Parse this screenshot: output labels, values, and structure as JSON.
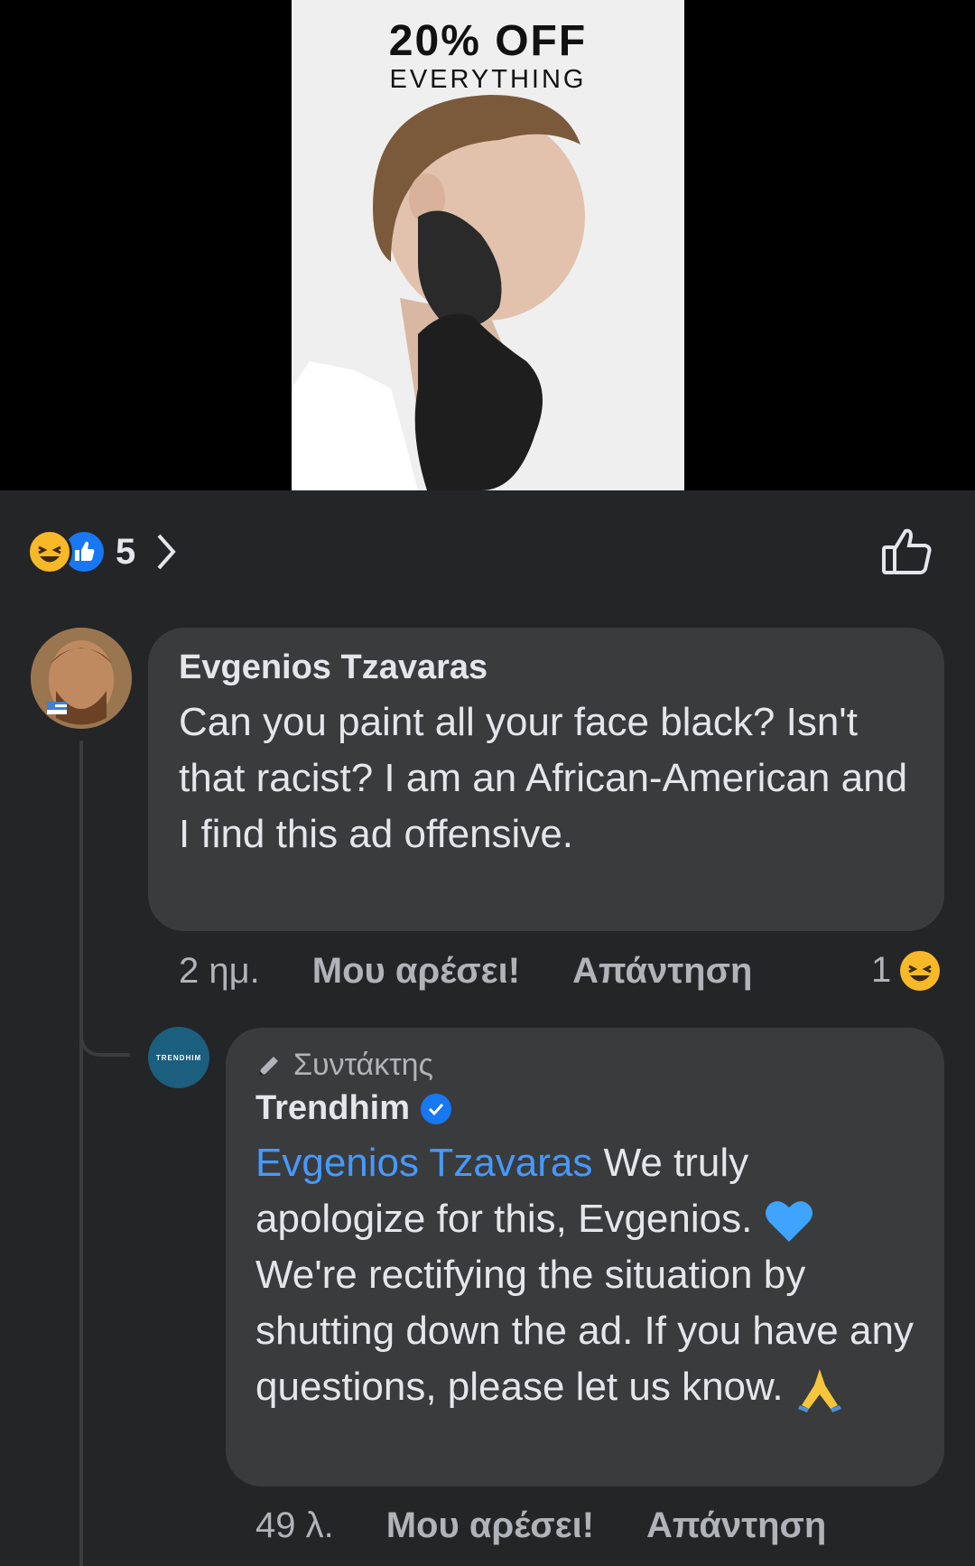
{
  "ad": {
    "headline": "20% OFF",
    "subline": "EVERYTHING"
  },
  "reactions": {
    "types": [
      "haha-icon",
      "like-icon"
    ],
    "count": "5"
  },
  "comments": [
    {
      "author": "Evgenios Tzavaras",
      "text": "Can you paint all your face black? Isn't that racist? I am an African-American and I find this ad offensive.",
      "time": "2 ημ.",
      "like_label": "Μου αρέσει!",
      "reply_label": "Απάντηση",
      "reaction_count": "1"
    }
  ],
  "reply": {
    "role": "Συντάκτης",
    "author": "Trendhim",
    "avatar_text": "TRENDHIM",
    "mention": "Evgenios Tzavaras",
    "text_part1": " We truly apologize for this, Evgenios. ",
    "text_part2": " We're rectifying the situation by shutting down the ad. If you have any questions, please let us know. ",
    "time": "49 λ.",
    "like_label": "Μου αρέσει!",
    "reply_label": "Απάντηση"
  },
  "colors": {
    "background": "#242527",
    "bubble": "#3a3b3c",
    "mention": "#4599ff",
    "like_blue": "#1877f2",
    "haha_yellow": "#f7b928"
  }
}
